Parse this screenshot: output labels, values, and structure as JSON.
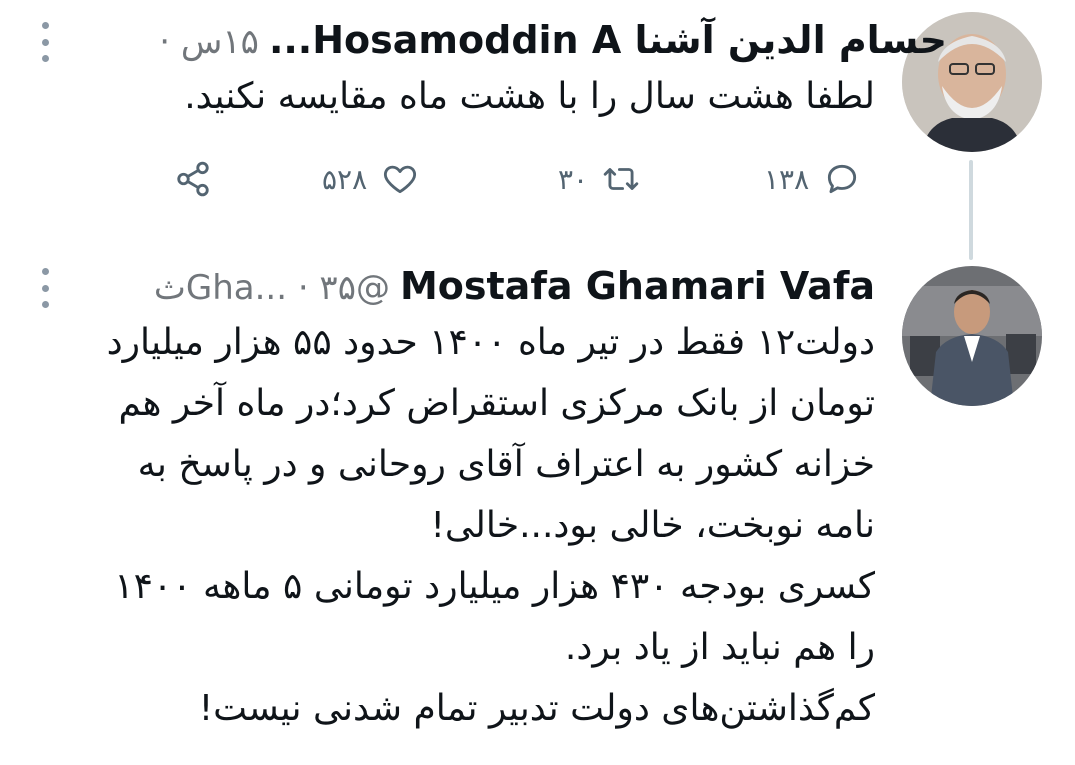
{
  "tweets": [
    {
      "display_name": "حسام الدین آشنا Hosamoddin A...",
      "meta": "۱۵س ·",
      "text": "لطفا هشت سال را با هشت ماه مقایسه نکنید.",
      "actions": {
        "reply_count": "۱۳۸",
        "retweet_count": "۳۰",
        "like_count": "۵۲۸"
      }
    },
    {
      "display_name": "Mostafa Ghamari Vafa",
      "meta": "@Gha... · ۳۵ث",
      "text": "دولت۱۲ فقط در تیر ماه ۱۴۰۰ حدود ۵۵ هزار میلیارد\nتومان از بانک مرکزی استقراض کرد؛در ماه آخر هم\nخزانه کشور به اعتراف آقای روحانی و در پاسخ به\nنامه نوبخت، خالی بود...خالی!\nکسری بودجه ۴۳۰ هزار میلیارد تومانی ۵ ماهه ۱۴۰۰\nرا هم نباید از یاد برد.\nکم‌گذاشتن‌های دولت تدبیر تمام شدنی نیست!"
    }
  ],
  "icons": [
    "more-options-icon",
    "reply-icon",
    "retweet-icon",
    "like-icon",
    "share-icon"
  ],
  "colors": {
    "text": "#0f1419",
    "secondary": "#71767b",
    "thread_line": "#cfd9de"
  }
}
